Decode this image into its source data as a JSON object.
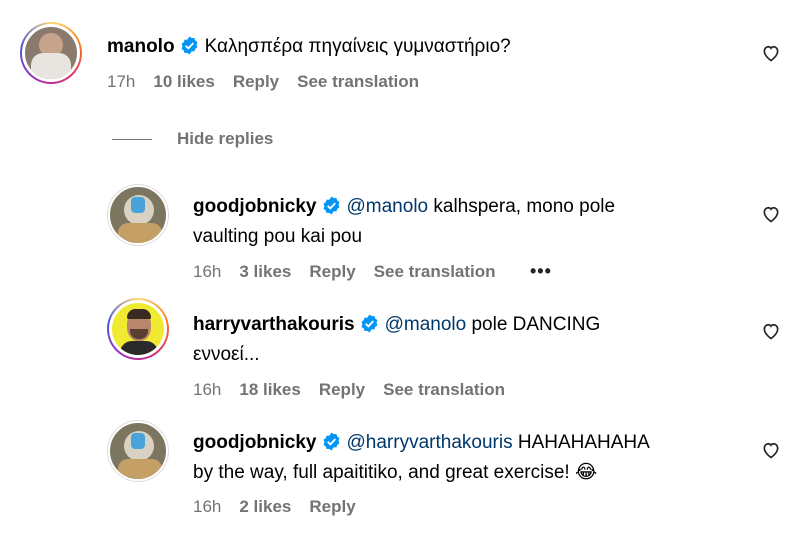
{
  "comments": [
    {
      "username": "manolo",
      "text": "Καλησπέρα πηγαίνεις γυμναστήριο?",
      "time": "17h",
      "likes": "10 likes",
      "reply": "Reply",
      "translate": "See translation"
    },
    {
      "username": "goodjobnicky",
      "mention": "@manolo",
      "text_line1": " kalhspera, mono pole",
      "text_line2": "vaulting pou kai pou",
      "time": "16h",
      "likes": "3 likes",
      "reply": "Reply",
      "translate": "See translation",
      "more": "•••"
    },
    {
      "username": "harryvarthakouris",
      "mention": "@manolo",
      "text_line1": " pole DANCING",
      "text_line2": "εννοεί...",
      "time": "16h",
      "likes": "18 likes",
      "reply": "Reply",
      "translate": "See translation"
    },
    {
      "username": "goodjobnicky",
      "mention": "@harryvarthakouris",
      "text_line1": " HAHAHAHAHA",
      "text_line2": "by the way, full apaititiko, and great exercise! ",
      "emoji": "😂",
      "time": "16h",
      "likes": "2 likes",
      "reply": "Reply"
    }
  ],
  "hide_replies": "Hide replies",
  "colors": {
    "verified": "#0095f6",
    "mention": "#00376b",
    "meta": "#737373"
  }
}
